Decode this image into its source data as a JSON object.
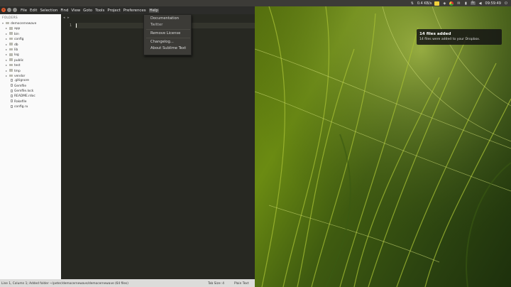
{
  "top_panel": {
    "network_speed": "0.4 KB/s",
    "keyboard_layout": "Fr",
    "clock": "09:59:49",
    "icons": [
      "dropbox-icon",
      "network-icon",
      "chrome-icon",
      "mail-icon",
      "battery-icon",
      "keyboard-icon",
      "volume-icon",
      "power-icon"
    ]
  },
  "menubar": {
    "items": [
      "File",
      "Edit",
      "Selection",
      "Find",
      "View",
      "Goto",
      "Tools",
      "Project",
      "Preferences",
      "Help"
    ]
  },
  "help_menu": {
    "items": [
      "Documentation",
      "Twitter",
      "Remove License",
      "Changelog...",
      "About Sublime Text"
    ]
  },
  "sidebar": {
    "header": "FOLDERS",
    "root": "democernewave",
    "folders": [
      "app",
      "bin",
      "config",
      "db",
      "lib",
      "log",
      "public",
      "test",
      "tmp",
      "vendor"
    ],
    "files": [
      ".gitignore",
      "Gemfile",
      "Gemfile.lock",
      "README.rdoc",
      "Rakefile",
      "config.ru"
    ]
  },
  "editor": {
    "tab_nav": "◂ ▸",
    "line_number": "1"
  },
  "statusbar": {
    "left": "Line 1, Column 1; Added folder ~/peter/democernewave/democernewave (64 files)",
    "tab_size": "Tab Size: 4",
    "syntax": "Plain Text"
  },
  "notification": {
    "title": "14 files added",
    "body": "14 files were added to your Dropbox."
  },
  "colors": {
    "accent_close": "#e25a2b",
    "editor_bg": "#272822",
    "panel_bg": "#3c3b37"
  }
}
